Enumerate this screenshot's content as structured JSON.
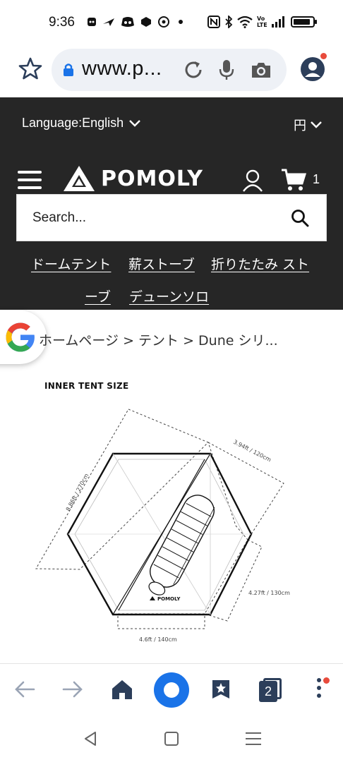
{
  "status_bar": {
    "time": "9:36",
    "left_icons": [
      "messenger-icon",
      "airplane-notify-icon",
      "discord-icon",
      "game-icon",
      "hotspot-icon",
      "dot-icon"
    ],
    "right_icons": [
      "nfc-icon",
      "bluetooth-icon",
      "wifi-icon",
      "volte-icon",
      "signal-icon",
      "battery-icon"
    ],
    "volte_label": "Vo LTE",
    "battery_level": 0.9
  },
  "browser": {
    "url": "www.p...",
    "notification_color": "#e84b3c",
    "accent_color": "#1a73e8"
  },
  "header": {
    "language_label": "Language:English",
    "currency_label": "円",
    "logo_text": "POMOLY",
    "cart_count": "1",
    "search_placeholder": "Search...",
    "background_color": "#262626"
  },
  "nav": {
    "links": [
      "ドームテント",
      "薪ストーブ",
      "折りたたみ スト",
      "ーブ",
      "デューンソロ"
    ]
  },
  "breadcrumb": {
    "text": "ホームページ > テント >  Dune シリ..."
  },
  "product_image": {
    "title": "INNER TENT SIZE",
    "dim_left": "8.86ft / 270cm",
    "dim_top_right": "3.94ft / 120cm",
    "dim_right": "4.27ft / 130cm",
    "dim_bottom": "4.6ft / 140cm",
    "brand_mark": "POMOLY"
  },
  "toolbar": {
    "tab_count": "2"
  }
}
